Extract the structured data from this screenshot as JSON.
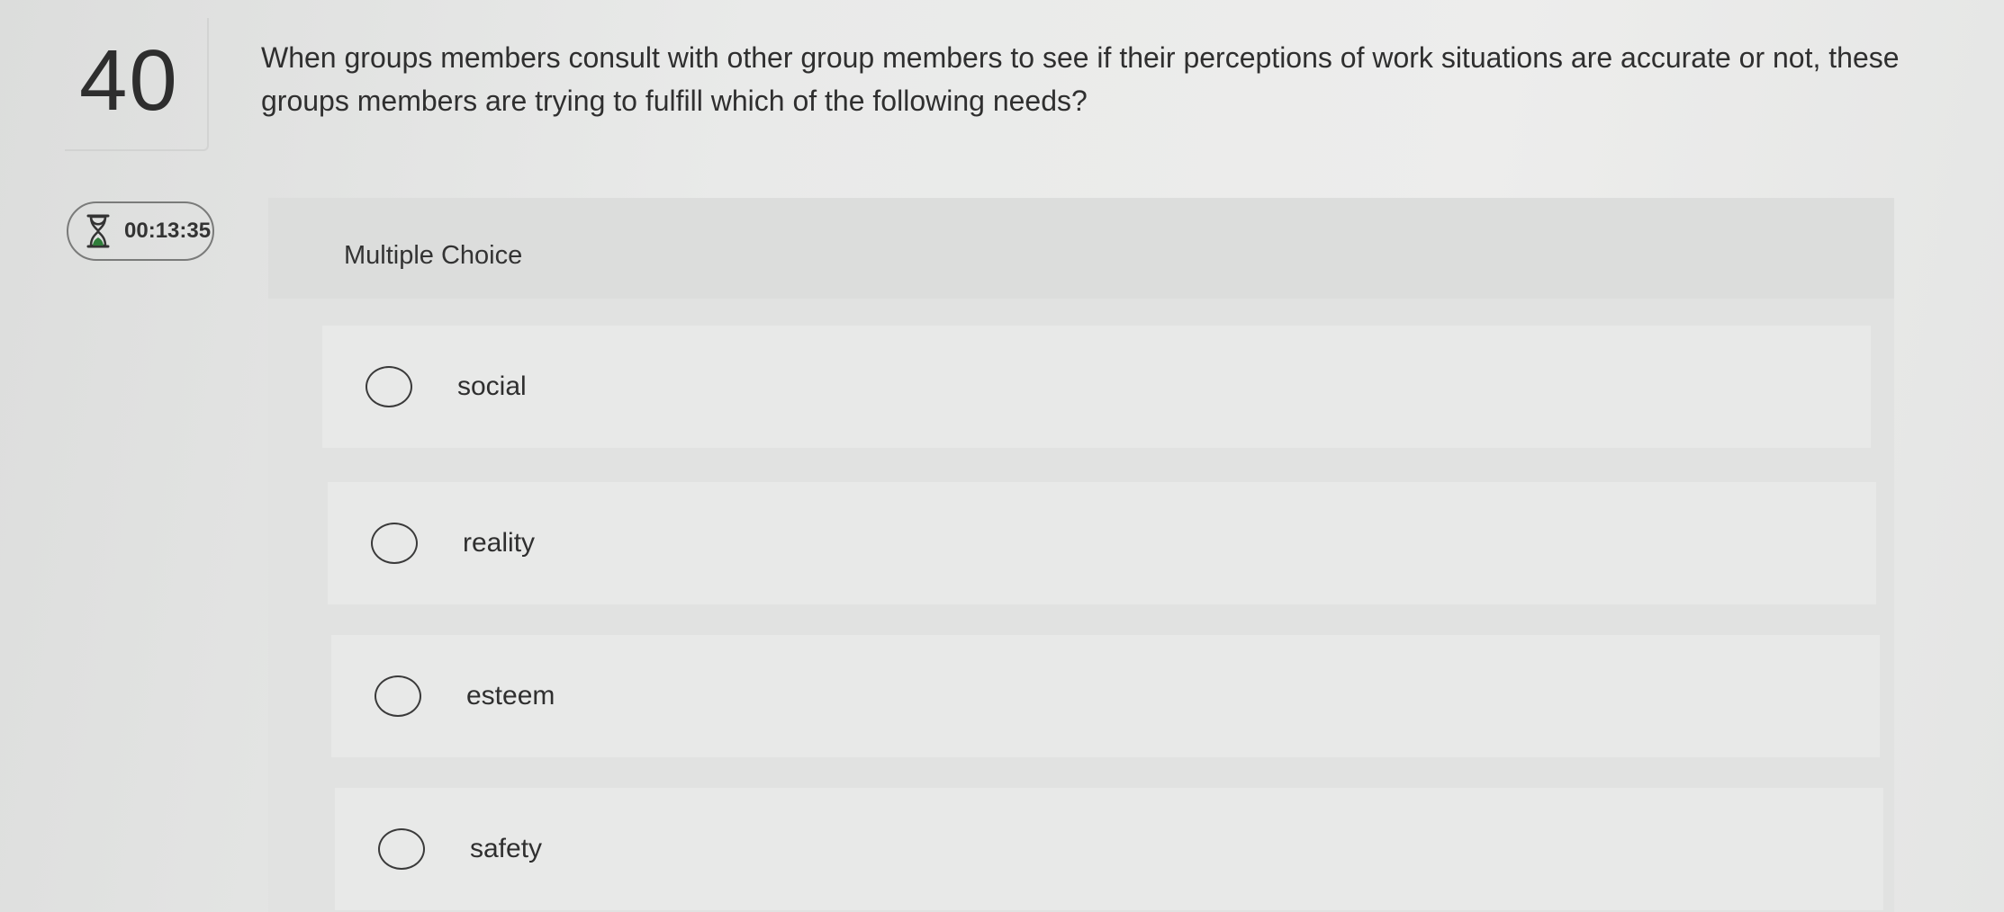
{
  "question": {
    "number": "40",
    "text": "When groups members consult with other group members to see if their perceptions of work situations are accurate or not, these groups members are trying to fulfill which of the following needs?"
  },
  "timer": {
    "icon": "hourglass-icon",
    "value": "00:13:35"
  },
  "card": {
    "title": "Multiple Choice"
  },
  "choices": [
    {
      "label": "social"
    },
    {
      "label": "reality"
    },
    {
      "label": "esteem"
    },
    {
      "label": "safety"
    }
  ]
}
